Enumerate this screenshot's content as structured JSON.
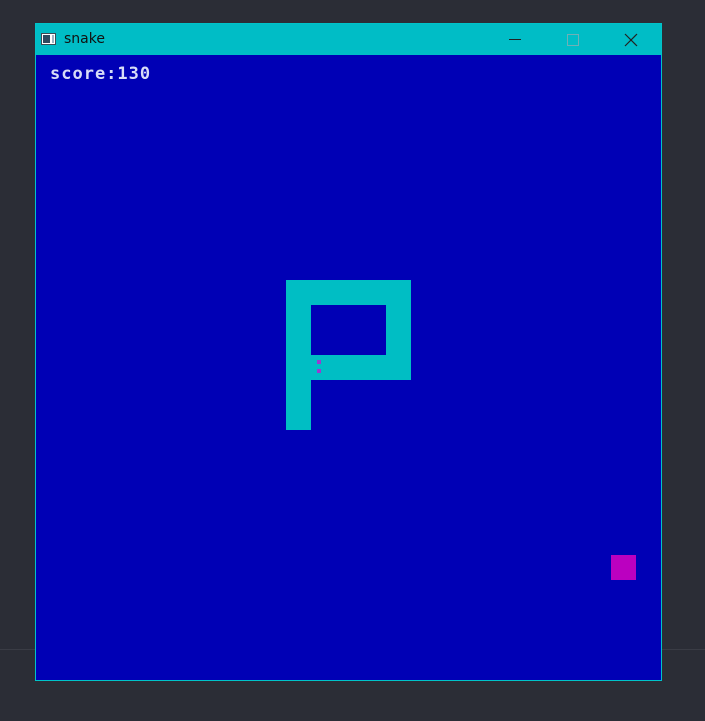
{
  "window": {
    "title": "snake",
    "titlebar_color": "#00bdc6",
    "background_color": "#0000b5"
  },
  "controls": {
    "minimize_icon": "minimize-icon",
    "maximize_icon": "maximize-icon",
    "close_icon": "close-icon"
  },
  "game": {
    "score_label": "score:",
    "score_value": "130",
    "snake_color": "#00bec4",
    "food_color": "#bb00c0",
    "eye_color": "#9a3ad0"
  }
}
